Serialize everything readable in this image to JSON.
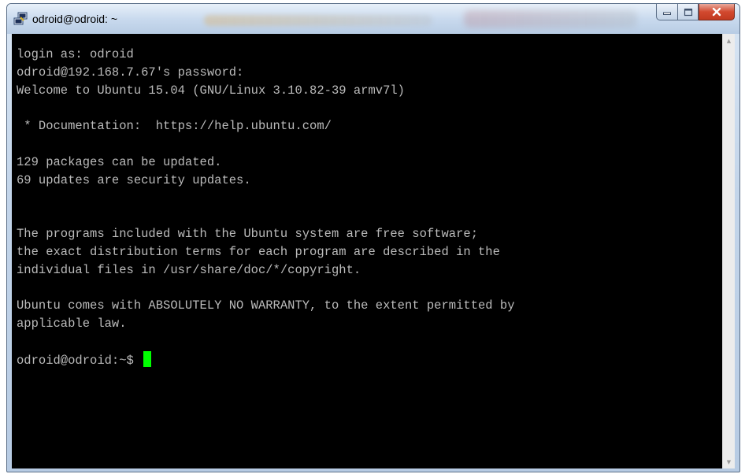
{
  "window": {
    "title": "odroid@odroid: ~"
  },
  "caption_icons": [
    "minimize-icon",
    "maximize-icon",
    "close-icon"
  ],
  "terminal": {
    "lines": [
      "login as: odroid",
      "odroid@192.168.7.67's password:",
      "Welcome to Ubuntu 15.04 (GNU/Linux 3.10.82-39 armv7l)",
      "",
      " * Documentation:  https://help.ubuntu.com/",
      "",
      "129 packages can be updated.",
      "69 updates are security updates.",
      "",
      "",
      "The programs included with the Ubuntu system are free software;",
      "the exact distribution terms for each program are described in the",
      "individual files in /usr/share/doc/*/copyright.",
      "",
      "Ubuntu comes with ABSOLUTELY NO WARRANTY, to the extent permitted by",
      "applicable law.",
      ""
    ],
    "prompt": "odroid@odroid:~$ ",
    "colors": {
      "background": "#000000",
      "text": "#bbbbbb",
      "cursor": "#00ff00"
    }
  }
}
